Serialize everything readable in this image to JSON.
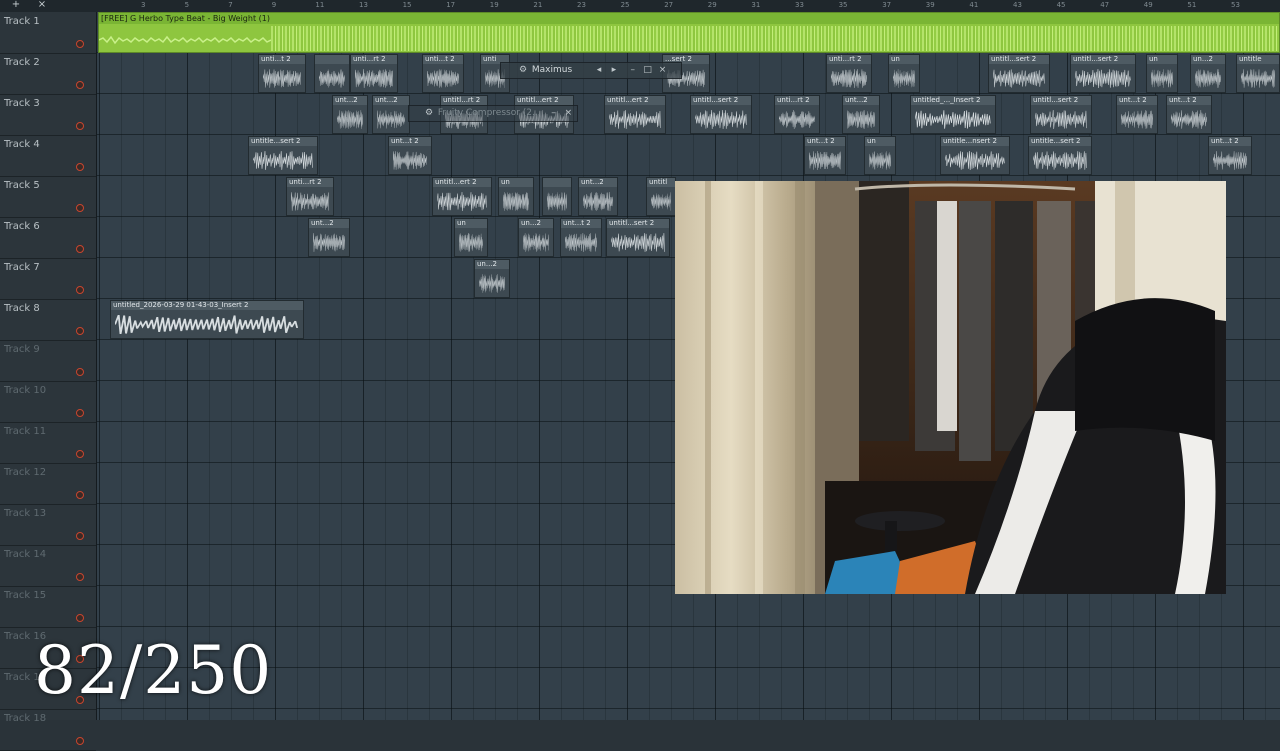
{
  "ruler": {
    "marks": [
      "3",
      "5",
      "7",
      "9",
      "11",
      "13",
      "15",
      "17",
      "19",
      "21",
      "23",
      "25",
      "27",
      "29",
      "31",
      "33",
      "35",
      "37",
      "39",
      "41",
      "43",
      "45",
      "47",
      "49",
      "51",
      "53"
    ],
    "tools": {
      "add": "+",
      "close": "×"
    }
  },
  "tracks": [
    {
      "name": "Track 1",
      "active": true
    },
    {
      "name": "Track 2",
      "active": true
    },
    {
      "name": "Track 3",
      "active": true
    },
    {
      "name": "Track 4",
      "active": true
    },
    {
      "name": "Track 5",
      "active": true
    },
    {
      "name": "Track 6",
      "active": true
    },
    {
      "name": "Track 7",
      "active": true
    },
    {
      "name": "Track 8",
      "active": true
    },
    {
      "name": "Track 9",
      "active": false
    },
    {
      "name": "Track 10",
      "active": false
    },
    {
      "name": "Track 11",
      "active": false
    },
    {
      "name": "Track 12",
      "active": false
    },
    {
      "name": "Track 13",
      "active": false
    },
    {
      "name": "Track 14",
      "active": false
    },
    {
      "name": "Track 15",
      "active": false
    },
    {
      "name": "Track 16",
      "active": false
    },
    {
      "name": "Track 17",
      "active": false
    },
    {
      "name": "Track 18",
      "active": false
    }
  ],
  "main_clip": {
    "title": "[FREE] G Herbo Type Beat - Big Weight (1)"
  },
  "clips": [
    {
      "track": 2,
      "start": 258,
      "width": 48,
      "title": "unti...t 2"
    },
    {
      "track": 2,
      "start": 314,
      "width": 36,
      "title": ""
    },
    {
      "track": 2,
      "start": 350,
      "width": 48,
      "title": "unti...rt 2"
    },
    {
      "track": 2,
      "start": 422,
      "width": 42,
      "title": "unti...t 2"
    },
    {
      "track": 2,
      "start": 480,
      "width": 30,
      "title": "unti"
    },
    {
      "track": 2,
      "start": 662,
      "width": 48,
      "title": "...sert 2"
    },
    {
      "track": 2,
      "start": 826,
      "width": 46,
      "title": "unti...rt 2"
    },
    {
      "track": 2,
      "start": 888,
      "width": 32,
      "title": "un"
    },
    {
      "track": 2,
      "start": 988,
      "width": 62,
      "title": "untitl...sert 2"
    },
    {
      "track": 2,
      "start": 1070,
      "width": 66,
      "title": "untitl...sert 2"
    },
    {
      "track": 2,
      "start": 1146,
      "width": 32,
      "title": "un"
    },
    {
      "track": 2,
      "start": 1190,
      "width": 36,
      "title": "un...2"
    },
    {
      "track": 2,
      "start": 1236,
      "width": 44,
      "title": "untitle"
    },
    {
      "track": 3,
      "start": 332,
      "width": 36,
      "title": "unt...2"
    },
    {
      "track": 3,
      "start": 372,
      "width": 38,
      "title": "unt...2"
    },
    {
      "track": 3,
      "start": 440,
      "width": 48,
      "title": "untitl...rt 2"
    },
    {
      "track": 3,
      "start": 514,
      "width": 60,
      "title": "untitl...ert 2"
    },
    {
      "track": 3,
      "start": 604,
      "width": 62,
      "title": "untitl...ert 2"
    },
    {
      "track": 3,
      "start": 690,
      "width": 62,
      "title": "untitl...sert 2"
    },
    {
      "track": 3,
      "start": 774,
      "width": 46,
      "title": "unti...rt 2"
    },
    {
      "track": 3,
      "start": 842,
      "width": 38,
      "title": "unt...2"
    },
    {
      "track": 3,
      "start": 910,
      "width": 86,
      "title": "untitled_..._Insert 2"
    },
    {
      "track": 3,
      "start": 1030,
      "width": 62,
      "title": "untitl...sert 2"
    },
    {
      "track": 3,
      "start": 1116,
      "width": 42,
      "title": "unt...t 2"
    },
    {
      "track": 3,
      "start": 1166,
      "width": 46,
      "title": "unt...t 2"
    },
    {
      "track": 4,
      "start": 248,
      "width": 70,
      "title": "untitle...sert 2"
    },
    {
      "track": 4,
      "start": 388,
      "width": 44,
      "title": "unt...t 2"
    },
    {
      "track": 4,
      "start": 804,
      "width": 42,
      "title": "unt...t 2"
    },
    {
      "track": 4,
      "start": 864,
      "width": 32,
      "title": "un"
    },
    {
      "track": 4,
      "start": 940,
      "width": 70,
      "title": "untitle...nsert 2"
    },
    {
      "track": 4,
      "start": 1028,
      "width": 64,
      "title": "untitle...sert 2"
    },
    {
      "track": 4,
      "start": 1208,
      "width": 44,
      "title": "unt...t 2"
    },
    {
      "track": 5,
      "start": 286,
      "width": 48,
      "title": "unti...rt 2"
    },
    {
      "track": 5,
      "start": 432,
      "width": 60,
      "title": "untitl...ert 2"
    },
    {
      "track": 5,
      "start": 498,
      "width": 36,
      "title": "un"
    },
    {
      "track": 5,
      "start": 542,
      "width": 30,
      "title": ""
    },
    {
      "track": 5,
      "start": 578,
      "width": 40,
      "title": "unt...2"
    },
    {
      "track": 5,
      "start": 646,
      "width": 30,
      "title": "untitl"
    },
    {
      "track": 6,
      "start": 308,
      "width": 42,
      "title": "unt...2"
    },
    {
      "track": 6,
      "start": 454,
      "width": 34,
      "title": "un"
    },
    {
      "track": 6,
      "start": 518,
      "width": 36,
      "title": "un...2"
    },
    {
      "track": 6,
      "start": 560,
      "width": 42,
      "title": "unt...t 2"
    },
    {
      "track": 6,
      "start": 606,
      "width": 64,
      "title": "untitl...sert 2"
    },
    {
      "track": 7,
      "start": 474,
      "width": 36,
      "title": "un...2"
    },
    {
      "track": 8,
      "start": 110,
      "width": 194,
      "title": "untitled_2026-03-29 01-43-03_Insert 2"
    }
  ],
  "windows": {
    "maximus": {
      "label": "Maximus",
      "icons": [
        "gear-icon",
        "arrow-left-icon",
        "arrow-right-icon",
        "minimize-icon",
        "maximize-icon",
        "close-icon"
      ]
    },
    "compressor": {
      "label": "Fruity Compressor (2...",
      "icons": [
        "gear-icon",
        "minimize-icon",
        "close-icon"
      ]
    }
  },
  "counter": {
    "text": "82/250"
  },
  "colors": {
    "accent_green": "#8ec63f",
    "grid": "#33404a",
    "record_dot": "#c8452e"
  }
}
